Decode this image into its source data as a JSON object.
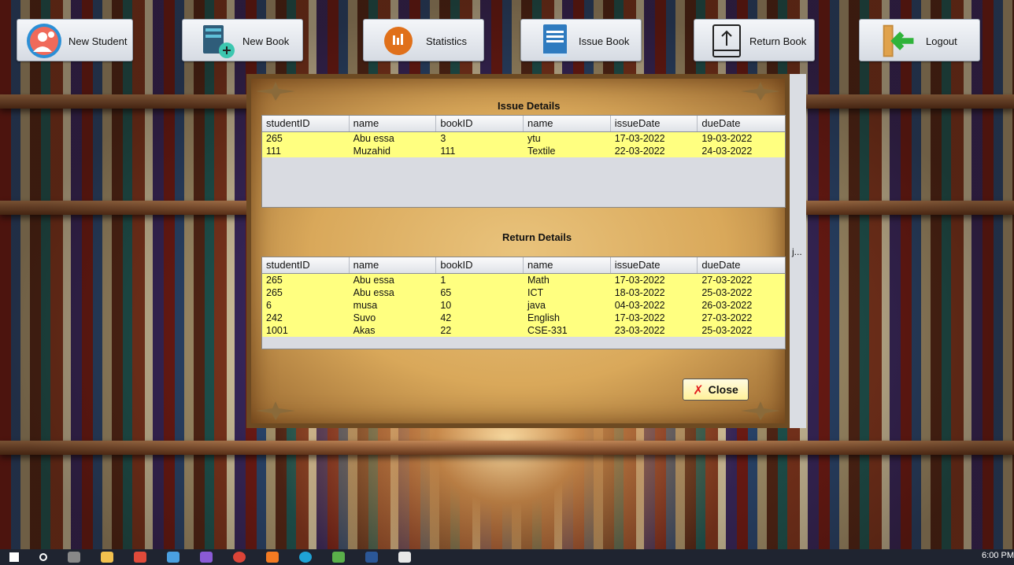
{
  "toolbar": {
    "new_student": "New Student",
    "new_book": "New Book",
    "statistics": "Statistics",
    "issue_book": "Issue Book",
    "return_book": "Return Book",
    "logout": "Logout"
  },
  "issue": {
    "title": "Issue Details",
    "columns": [
      "studentID",
      "name",
      "bookID",
      "name",
      "issueDate",
      "dueDate"
    ],
    "rows": [
      [
        "265",
        "Abu essa",
        "3",
        "ytu",
        "17-03-2022",
        "19-03-2022"
      ],
      [
        "111",
        "Muzahid",
        "111",
        "Textile",
        "22-03-2022",
        "24-03-2022"
      ]
    ]
  },
  "return": {
    "title": "Return Details",
    "columns": [
      "studentID",
      "name",
      "bookID",
      "name",
      "issueDate",
      "dueDate"
    ],
    "rows": [
      [
        "265",
        "Abu essa",
        "1",
        "Math",
        "17-03-2022",
        "27-03-2022"
      ],
      [
        "265",
        "Abu essa",
        "65",
        "ICT",
        "18-03-2022",
        "25-03-2022"
      ],
      [
        "6",
        "musa",
        "10",
        "java",
        "04-03-2022",
        "26-03-2022"
      ],
      [
        "242",
        "Suvo",
        "42",
        "English",
        "17-03-2022",
        "27-03-2022"
      ],
      [
        "1001",
        "Akas",
        "22",
        "CSE-331",
        "23-03-2022",
        "25-03-2022"
      ]
    ]
  },
  "dialog": {
    "close_label": "Close",
    "truncated_label": "j..."
  },
  "taskbar": {
    "time": "6:00 PM"
  }
}
